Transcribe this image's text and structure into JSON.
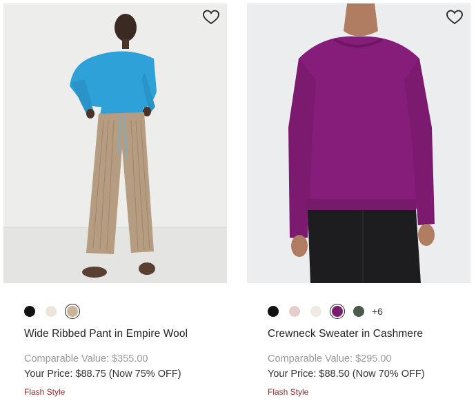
{
  "products": [
    {
      "name": "Wide Ribbed Pant in Empire Wool",
      "swatches": [
        {
          "color": "#111111",
          "selected": false
        },
        {
          "color": "#ece6da",
          "selected": false
        },
        {
          "color": "#c9b49a",
          "selected": true
        }
      ],
      "more_colors": "",
      "comparable_value": "Comparable Value: $355.00",
      "your_price": "Your Price: $88.75 (Now 75% OFF)",
      "badge": "Flash Style",
      "wishlist_icon": "heart-outline-icon"
    },
    {
      "name": "Crewneck Sweater in Cashmere",
      "swatches": [
        {
          "color": "#111111",
          "selected": false
        },
        {
          "color": "#e6cfca",
          "selected": false
        },
        {
          "color": "#efebe4",
          "selected": false
        },
        {
          "color": "#7a1d6e",
          "selected": true
        },
        {
          "color": "#4b5a4a",
          "selected": false
        }
      ],
      "more_colors": "+6",
      "comparable_value": "Comparable Value: $295.00",
      "your_price": "Your Price: $88.50 (Now 70% OFF)",
      "badge": "Flash Style",
      "wishlist_icon": "heart-outline-icon"
    }
  ]
}
